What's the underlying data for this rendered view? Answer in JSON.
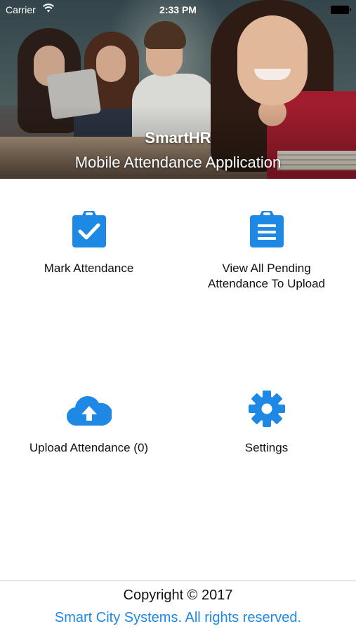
{
  "status_bar": {
    "carrier": "Carrier",
    "time": "2:33 PM",
    "wifi_icon": "wifi-icon",
    "battery_icon": "battery-icon"
  },
  "header": {
    "title": "SmartHR",
    "subtitle": "Mobile Attendance Application",
    "background_image": "students-classroom-photo"
  },
  "menu": {
    "items": [
      {
        "label": "Mark Attendance",
        "icon": "clipboard-check-icon"
      },
      {
        "label": "View All Pending Attendance To Upload",
        "icon": "clipboard-list-icon"
      },
      {
        "label": "Upload Attendance (0)",
        "icon": "cloud-upload-icon"
      },
      {
        "label": "Settings",
        "icon": "gear-icon"
      }
    ]
  },
  "footer": {
    "copyright": "Copyright © 2017",
    "rights": "Smart City Systems. All rights reserved."
  },
  "colors": {
    "accent": "#1e88e5",
    "text": "#111111",
    "background": "#ffffff"
  }
}
